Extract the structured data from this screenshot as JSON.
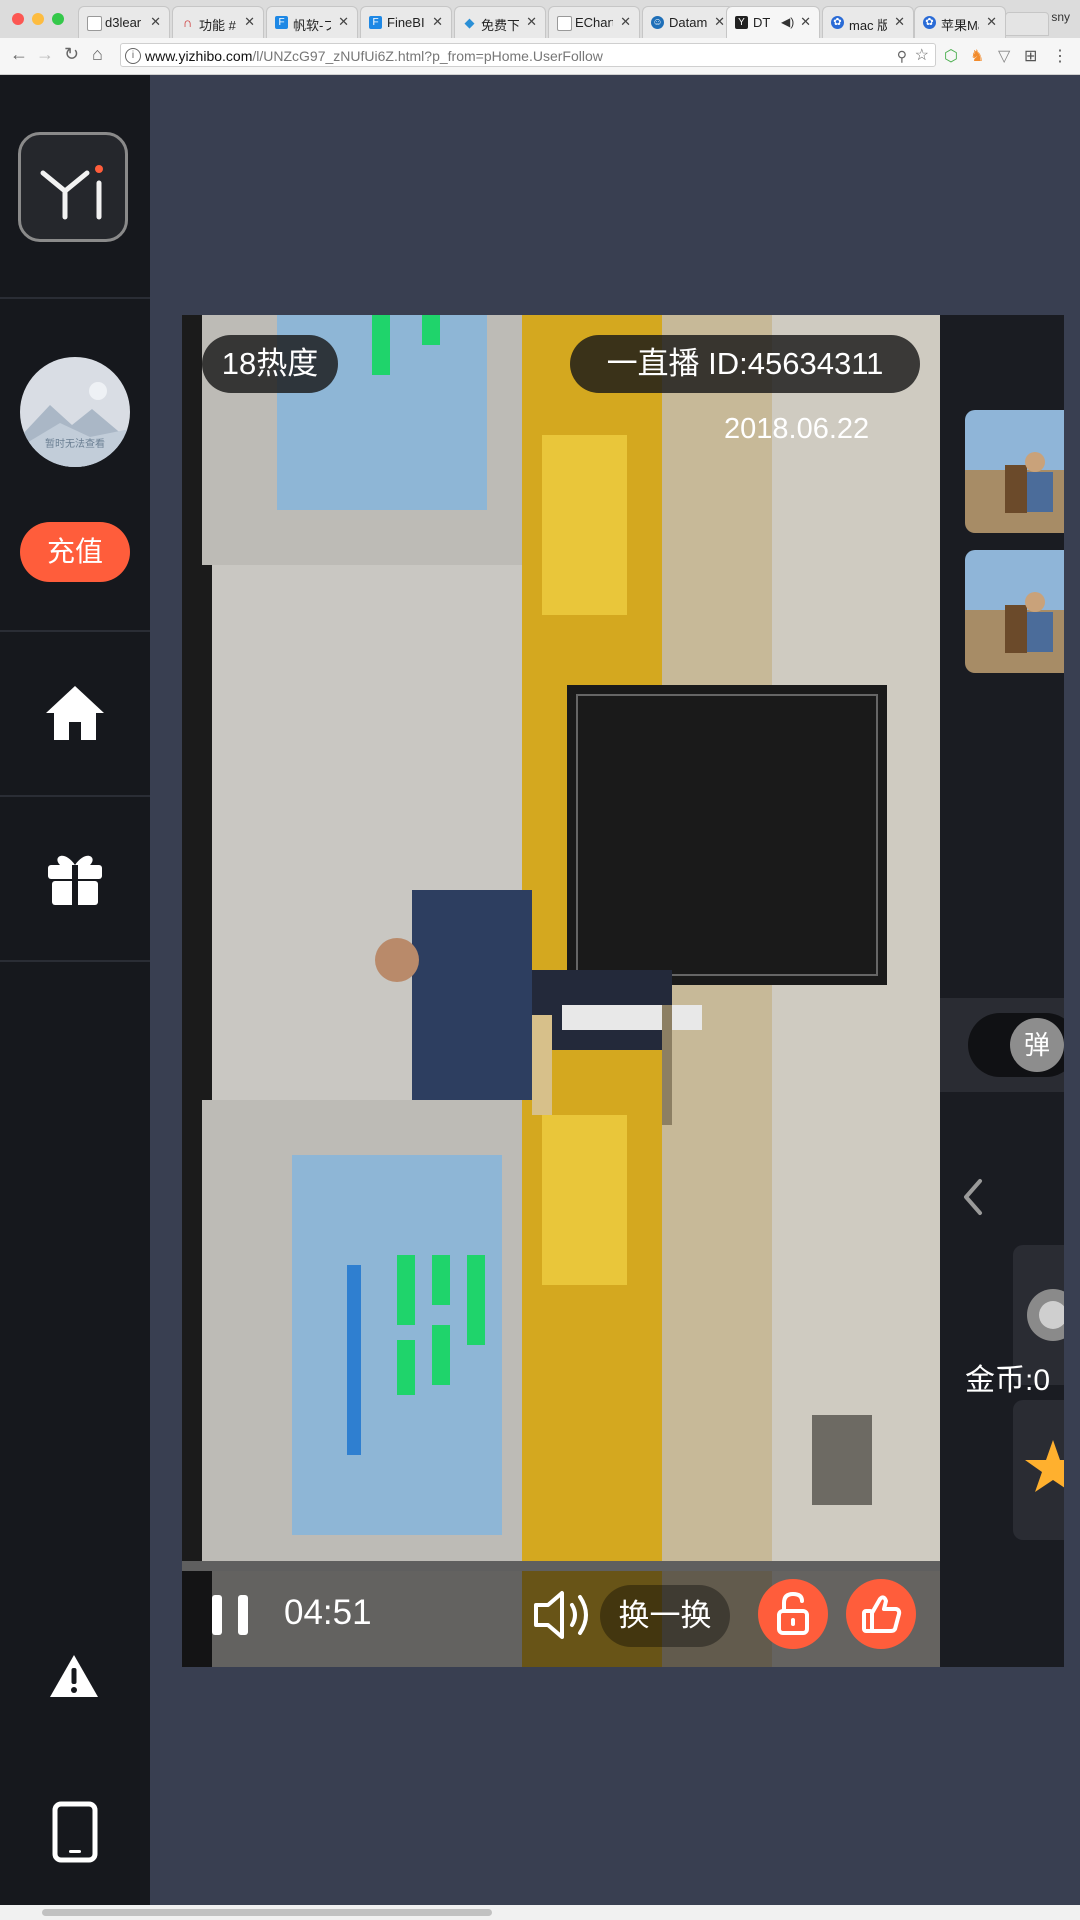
{
  "browser": {
    "tabs": [
      {
        "label": "d3lear",
        "favicon_color": "#9a9a9a"
      },
      {
        "label": "功能 #",
        "favicon_color": "#cc2a2a"
      },
      {
        "label": "帆软-プ",
        "favicon_color": "#1e88e5"
      },
      {
        "label": "FineBI",
        "favicon_color": "#1e88e5"
      },
      {
        "label": "免费下",
        "favicon_color": "#2a8fd6"
      },
      {
        "label": "EChart",
        "favicon_color": "#9a9a9a"
      },
      {
        "label": "Datam",
        "favicon_color": "#1f6fb8"
      },
      {
        "label": "DT",
        "favicon_color": "#222222",
        "active": true
      },
      {
        "label": "mac 版",
        "favicon_color": "#2a6bd6"
      },
      {
        "label": "苹果Ma",
        "favicon_color": "#2a6bd6"
      }
    ],
    "profile": "sny",
    "url_host": "www.yizhibo.com",
    "url_path": "/l/UNZcG97_zNUfUi6Z.html?p_from=pHome.UserFollow"
  },
  "sidebar": {
    "avatar_text": "暂时无法查看",
    "recharge_label": "充值",
    "icons": [
      "logo-icon",
      "home-icon",
      "gift-icon",
      "warning-icon",
      "phone-icon"
    ]
  },
  "player": {
    "heat_label": "18热度",
    "channel_label": "一直播 ID:45634311",
    "date": "2018.06.22",
    "time": "04:51",
    "switch_label": "换一换",
    "progress": 0,
    "accent_color": "#ff5d3b"
  },
  "right_panel": {
    "danmu_label": "弹",
    "coins_label": "金币:0"
  }
}
